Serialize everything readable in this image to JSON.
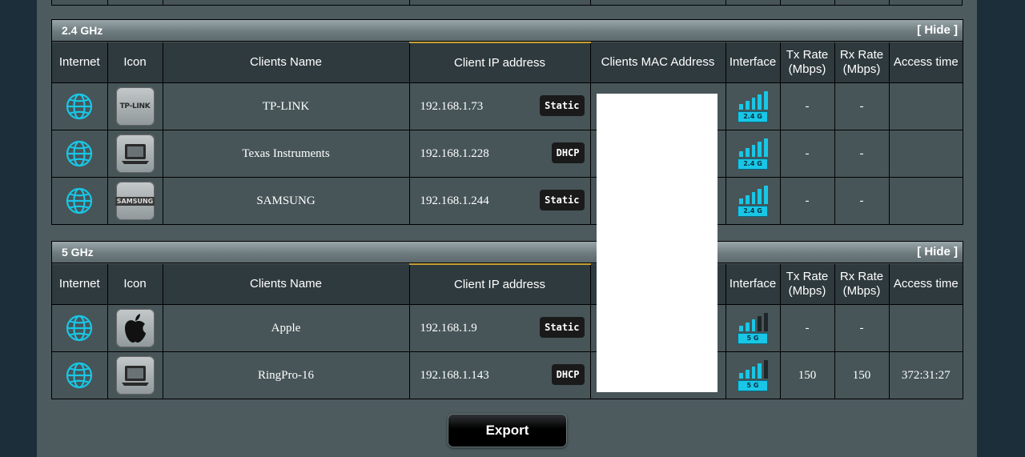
{
  "columns": {
    "internet": "Internet",
    "icon": "Icon",
    "name": "Clients Name",
    "ip": "Client IP address",
    "mac": "Clients MAC Address",
    "interface": "Interface",
    "tx": "Tx Rate (Mbps)",
    "rx": "Rx Rate (Mbps)",
    "access": "Access time"
  },
  "hide_label": "[ Hide ]",
  "export_label": "Export",
  "signal_color": "#19c6e6",
  "sections": [
    {
      "title": "2.4 GHz",
      "clients": [
        {
          "icon": "tp-link-logo-icon",
          "logo_text": "TP-LINK",
          "name": "TP-LINK",
          "ip": "192.168.1.73",
          "type": "Static",
          "band": "2.4 G",
          "signal_bars": 4,
          "tx": "-",
          "rx": "-",
          "access": ""
        },
        {
          "icon": "laptop-icon",
          "logo_text": "",
          "name": "Texas Instruments",
          "ip": "192.168.1.228",
          "type": "DHCP",
          "band": "2.4 G",
          "signal_bars": 4,
          "tx": "-",
          "rx": "-",
          "access": ""
        },
        {
          "icon": "samsung-logo-icon",
          "logo_text": "SAMSUNG",
          "name": "SAMSUNG",
          "ip": "192.168.1.244",
          "type": "Static",
          "band": "2.4 G",
          "signal_bars": 4,
          "tx": "-",
          "rx": "-",
          "access": ""
        }
      ]
    },
    {
      "title": "5 GHz",
      "clients": [
        {
          "icon": "apple-logo-icon",
          "logo_text": "",
          "name": "Apple",
          "ip": "192.168.1.9",
          "type": "Static",
          "band": "5 G",
          "signal_bars": 2,
          "tx": "-",
          "rx": "-",
          "access": ""
        },
        {
          "icon": "laptop-icon",
          "logo_text": "",
          "name": "RingPro-16",
          "ip": "192.168.1.143",
          "type": "DHCP",
          "band": "5 G",
          "signal_bars": 3,
          "tx": "150",
          "rx": "150",
          "access": "372:31:27"
        }
      ]
    }
  ]
}
